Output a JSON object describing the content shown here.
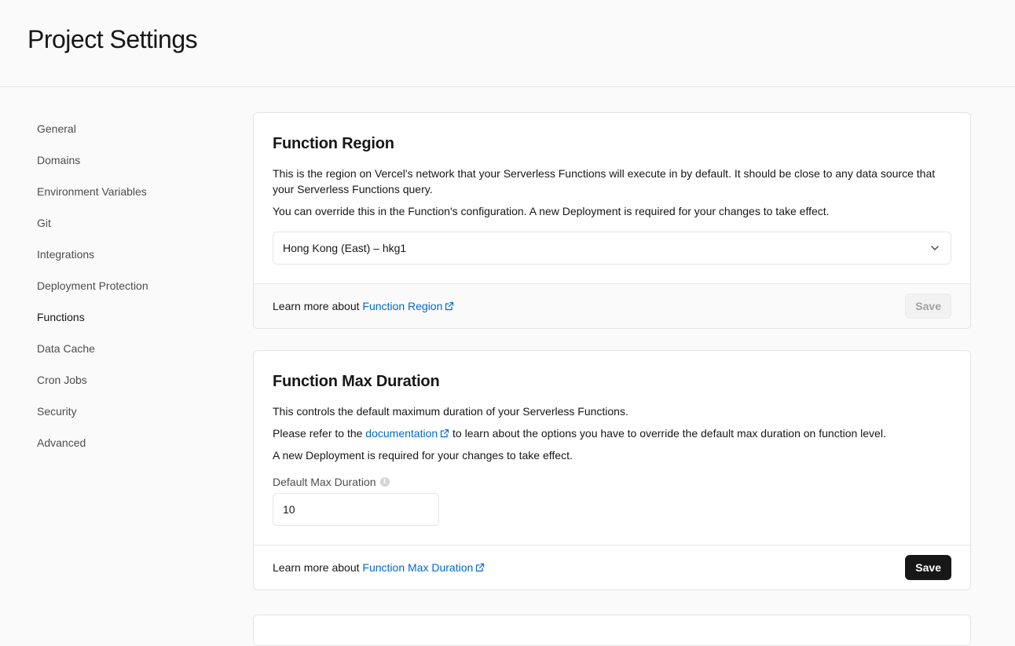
{
  "page": {
    "title": "Project Settings"
  },
  "sidebar": {
    "items": [
      {
        "label": "General"
      },
      {
        "label": "Domains"
      },
      {
        "label": "Environment Variables"
      },
      {
        "label": "Git"
      },
      {
        "label": "Integrations"
      },
      {
        "label": "Deployment Protection"
      },
      {
        "label": "Functions",
        "active": true
      },
      {
        "label": "Data Cache"
      },
      {
        "label": "Cron Jobs"
      },
      {
        "label": "Security"
      },
      {
        "label": "Advanced"
      }
    ]
  },
  "function_region": {
    "title": "Function Region",
    "description": "This is the region on Vercel's network that your Serverless Functions will execute in by default. It should be close to any data source that your Serverless Functions query.",
    "override_note": "You can override this in the Function's configuration. A new Deployment is required for your changes to take effect.",
    "selected_region": "Hong Kong (East) – hkg1",
    "footer_prefix": "Learn more about",
    "footer_link": "Function Region",
    "save_label": "Save"
  },
  "function_max_duration": {
    "title": "Function Max Duration",
    "description": "This controls the default maximum duration of your Serverless Functions.",
    "refer_prefix": "Please refer to the",
    "refer_link": "documentation",
    "refer_suffix": "to learn about the options you have to override the default max duration on function level.",
    "deploy_note": "A new Deployment is required for your changes to take effect.",
    "field_label": "Default Max Duration",
    "field_value": "10",
    "footer_prefix": "Learn more about",
    "footer_link": "Function Max Duration",
    "save_label": "Save"
  },
  "icons": {
    "external": "external-link-icon",
    "chevron": "chevron-down-icon",
    "info": "info-icon"
  },
  "colors": {
    "link": "#0068d6",
    "primary_button": "#171717",
    "background": "#fafafa"
  }
}
